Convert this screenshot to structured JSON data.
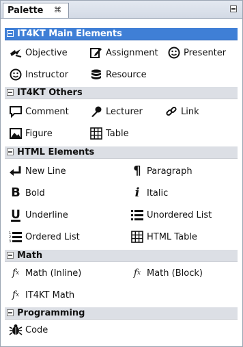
{
  "tab": {
    "label": "Palette",
    "close_glyph": "⌘"
  },
  "categories": {
    "main": {
      "label": "IT4KT Main Elements",
      "selected": true
    },
    "others": {
      "label": "IT4KT Others"
    },
    "html": {
      "label": "HTML Elements"
    },
    "math": {
      "label": "Math"
    },
    "prog": {
      "label": "Programming"
    }
  },
  "items": {
    "objective": "Objective",
    "assignment": "Assignment",
    "presenter": "Presenter",
    "instructor": "Instructor",
    "resource": "Resource",
    "comment": "Comment",
    "lecturer": "Lecturer",
    "link": "Link",
    "figure": "Figure",
    "table": "Table",
    "new_line": "New Line",
    "paragraph": "Paragraph",
    "bold": "Bold",
    "italic": "Italic",
    "underline": "Underline",
    "unordered_list": "Unordered List",
    "ordered_list": "Ordered List",
    "html_table": "HTML Table",
    "math_inline": "Math (Inline)",
    "math_block": "Math (Block)",
    "it4kt_math": "IT4KT Math",
    "code": "Code"
  },
  "glyphs": {
    "paragraph": "¶",
    "bold": "B",
    "italic": "i",
    "underline": "U",
    "fx": "f"
  },
  "colors": {
    "selected_category": "#3f7fd6",
    "category_bg": "#dcdfe5"
  }
}
